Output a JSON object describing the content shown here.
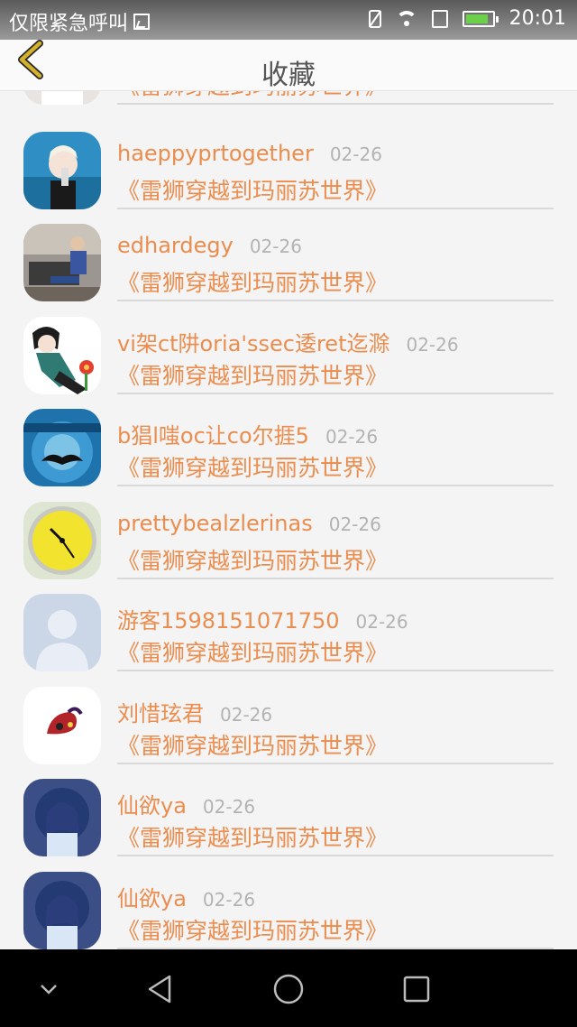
{
  "status_bar": {
    "carrier": "仅限紧急呼叫",
    "time": "20:01"
  },
  "header": {
    "title": "收藏"
  },
  "items": [
    {
      "name": "",
      "date": "",
      "title": "《雷狮穿越到玛丽苏世界》",
      "avatar": "girl-photo-avatar"
    },
    {
      "name": "haeppyprtogether",
      "date": "02-26",
      "title": "《雷狮穿越到玛丽苏世界》",
      "avatar": "blonde-person-avatar"
    },
    {
      "name": "edhardegy",
      "date": "02-26",
      "title": "《雷狮穿越到玛丽苏世界》",
      "avatar": "sofa-men-avatar"
    },
    {
      "name": "vi架ct阱oria'ssec逶ret迄滁",
      "date": "02-26",
      "title": "《雷狮穿越到玛丽苏世界》",
      "avatar": "anime-boy-flower-avatar"
    },
    {
      "name": "b猖l嗤oc让co尔捱5",
      "date": "02-26",
      "title": "《雷狮穿越到玛丽苏世界》",
      "avatar": "mustache-poster-avatar"
    },
    {
      "name": "prettybealzlerinas",
      "date": "02-26",
      "title": "《雷狮穿越到玛丽苏世界》",
      "avatar": "yellow-clock-avatar"
    },
    {
      "name": "游客1598151071750",
      "date": "02-26",
      "title": "《雷狮穿越到玛丽苏世界》",
      "avatar": "default-user-avatar"
    },
    {
      "name": "刘惜玹君",
      "date": "02-26",
      "title": "《雷狮穿越到玛丽苏世界》",
      "avatar": "red-hat-avatar"
    },
    {
      "name": "仙欲ya",
      "date": "02-26",
      "title": "《雷狮穿越到玛丽苏世界》",
      "avatar": "anime-girl-avatar"
    },
    {
      "name": "仙欲ya",
      "date": "02-26",
      "title": "《雷狮穿越到玛丽苏世界》",
      "avatar": "anime-girl-avatar"
    }
  ],
  "colors": {
    "accent": "#ea8d4e",
    "date": "#b3b3b3",
    "back_arrow": "#d4b12a"
  },
  "nav": {
    "icons": [
      "chevron-down-icon",
      "back-triangle-icon",
      "home-circle-icon",
      "recents-square-icon"
    ]
  }
}
